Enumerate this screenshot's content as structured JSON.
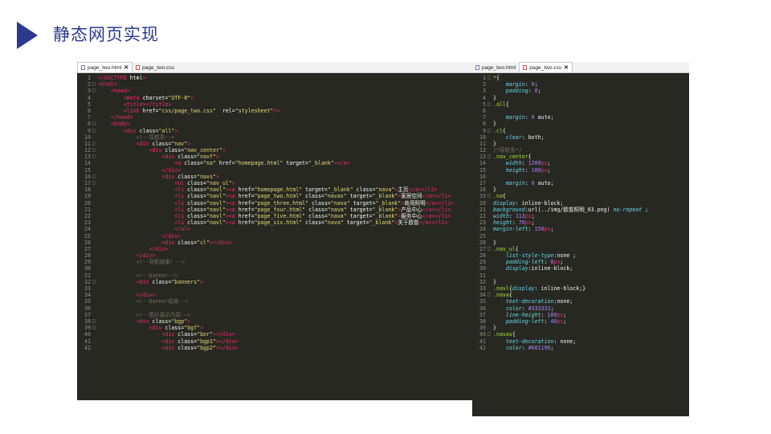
{
  "slide": {
    "title": "静态网页实现"
  },
  "html_editor": {
    "tabs": [
      {
        "label": "page_two.html",
        "active": true,
        "closable": true
      },
      {
        "label": "page_two.css",
        "active": false,
        "closable": false
      }
    ],
    "lines": [
      {
        "n": "1",
        "fold": "",
        "t": "<!DOCTYPE html>"
      },
      {
        "n": "2",
        "fold": "□",
        "t": "<html>"
      },
      {
        "n": "3",
        "fold": "□",
        "t": "    <head>"
      },
      {
        "n": "4",
        "fold": "",
        "t": "        <meta charset=\"UTF-8\">"
      },
      {
        "n": "5",
        "fold": "",
        "t": "        <title></title>"
      },
      {
        "n": "6",
        "fold": "",
        "t": "        <link href=\"css/page_two.css\"  rel=\"stylesheet\"/>"
      },
      {
        "n": "7",
        "fold": "",
        "t": "    </head>"
      },
      {
        "n": "8",
        "fold": "□",
        "t": "    <body>"
      },
      {
        "n": "9",
        "fold": "□",
        "t": "        <div class=\"all\">"
      },
      {
        "n": "10",
        "fold": "",
        "t": "            <!--导航条-->"
      },
      {
        "n": "11",
        "fold": "□",
        "t": "            <div class=\"nav\">"
      },
      {
        "n": "12",
        "fold": "□",
        "t": "                <div class=\"nav_center\">"
      },
      {
        "n": "13",
        "fold": "□",
        "t": "                    <div class=\"navf\">"
      },
      {
        "n": "14",
        "fold": "",
        "t": "                        <a class=\"na\" href=\"homepage.html\" target=\"_blank\"></a>"
      },
      {
        "n": "15",
        "fold": "",
        "t": "                    </div>"
      },
      {
        "n": "16",
        "fold": "□",
        "t": "                    <div class=\"navs\">"
      },
      {
        "n": "17",
        "fold": "□",
        "t": "                        <ul class=\"nav_ul\">"
      },
      {
        "n": "18",
        "fold": "",
        "t": "                        <li class=\"navl\"><a href=\"homepage.html\" target=\"_blank\" class=\"nava\">主页</a></li>"
      },
      {
        "n": "19",
        "fold": "",
        "t": "                        <li class=\"navl\"><a href=\"page_two.html\" class=\"navas\" target=\"_blank\">家居空间</a></li>"
      },
      {
        "n": "20",
        "fold": "",
        "t": "                        <li class=\"navl\"><a href=\"page_three.html\" class=\"nava\" target=\"_blank\">商用照明</a></li>"
      },
      {
        "n": "21",
        "fold": "",
        "t": "                        <li class=\"navl\"><a href=\"page_four.html\" class=\"nava\" target=\"_blank\">产品中心</a></li>"
      },
      {
        "n": "22",
        "fold": "",
        "t": "                        <li class=\"navl\"><a href=\"page_five.html\" class=\"nava\" target=\"_blank\">服务中心</a></li>"
      },
      {
        "n": "23",
        "fold": "",
        "t": "                        <li class=\"navl\"><a href=\"page_six.html\" class=\"nava\" target=\"_blank\">关于欧普</a></li>"
      },
      {
        "n": "24",
        "fold": "",
        "t": "                        </ul>"
      },
      {
        "n": "25",
        "fold": "",
        "t": "                    </div>"
      },
      {
        "n": "26",
        "fold": "",
        "t": "                    <div class=\"cl\"></div>"
      },
      {
        "n": "27",
        "fold": "",
        "t": "                </div>"
      },
      {
        "n": "28",
        "fold": "",
        "t": "            </div>"
      },
      {
        "n": "29",
        "fold": "",
        "t": "            <!--导航结束！-->"
      },
      {
        "n": "30",
        "fold": "",
        "t": ""
      },
      {
        "n": "31",
        "fold": "",
        "t": "            <!--banner-->"
      },
      {
        "n": "32",
        "fold": "□",
        "t": "            <div class=\"banners\">"
      },
      {
        "n": "33",
        "fold": "",
        "t": ""
      },
      {
        "n": "34",
        "fold": "",
        "t": "            </div>"
      },
      {
        "n": "35",
        "fold": "",
        "t": "            <!--banner结束-->"
      },
      {
        "n": "36",
        "fold": "",
        "t": ""
      },
      {
        "n": "37",
        "fold": "",
        "t": "            <!--图片展示内容-->"
      },
      {
        "n": "38",
        "fold": "□",
        "t": "            <div class=\"bgp\">"
      },
      {
        "n": "39",
        "fold": "□",
        "t": "                <div class=\"bgf\">"
      },
      {
        "n": "40",
        "fold": "",
        "t": "                    <div class=\"bor\"></div>"
      },
      {
        "n": "41",
        "fold": "",
        "t": "                    <div class=\"bgp1\"></div>"
      },
      {
        "n": "42",
        "fold": "",
        "t": "                    <div class=\"bgp2\"></div>"
      }
    ]
  },
  "css_editor": {
    "tabs": [
      {
        "label": "page_two.html",
        "active": false,
        "closable": false
      },
      {
        "label": "page_two.css",
        "active": true,
        "closable": true
      }
    ],
    "lines": [
      {
        "n": "1",
        "fold": "□",
        "t": "*{"
      },
      {
        "n": "2",
        "fold": "",
        "t": "    margin: 0;"
      },
      {
        "n": "3",
        "fold": "",
        "t": "    padding: 0;"
      },
      {
        "n": "4",
        "fold": "",
        "t": "}"
      },
      {
        "n": "5",
        "fold": "□",
        "t": ".all{"
      },
      {
        "n": "6",
        "fold": "",
        "t": ""
      },
      {
        "n": "7",
        "fold": "",
        "t": "    margin: 0 auto;"
      },
      {
        "n": "8",
        "fold": "",
        "t": "}"
      },
      {
        "n": "9",
        "fold": "□",
        "t": ".cl{"
      },
      {
        "n": "10",
        "fold": "",
        "t": "    clear: both;"
      },
      {
        "n": "11",
        "fold": "",
        "t": "}"
      },
      {
        "n": "12",
        "fold": "",
        "t": "/*导航条*/"
      },
      {
        "n": "13",
        "fold": "□",
        "t": ".nav_center{"
      },
      {
        "n": "14",
        "fold": "",
        "t": "    width: 1200px;"
      },
      {
        "n": "15",
        "fold": "",
        "t": "    height: 100px;"
      },
      {
        "n": "16",
        "fold": "",
        "t": ""
      },
      {
        "n": "17",
        "fold": "",
        "t": "    margin: 0 auto;"
      },
      {
        "n": "18",
        "fold": "",
        "t": "}"
      },
      {
        "n": "19",
        "fold": "□",
        "t": ".na{"
      },
      {
        "n": "20",
        "fold": "",
        "t": "display: inline-block;"
      },
      {
        "n": "21",
        "fold": "",
        "t": "background:url(../img/欧普照明_03.png) no-repeat ;"
      },
      {
        "n": "22",
        "fold": "",
        "t": "width: 113px;"
      },
      {
        "n": "23",
        "fold": "",
        "t": "height: 70px;"
      },
      {
        "n": "24",
        "fold": "",
        "t": "margin-left: 150px;"
      },
      {
        "n": "25",
        "fold": "",
        "t": ""
      },
      {
        "n": "26",
        "fold": "",
        "t": "}"
      },
      {
        "n": "27",
        "fold": "□",
        "t": ".nav_ul{"
      },
      {
        "n": "28",
        "fold": "",
        "t": "    list-style-type:none ;"
      },
      {
        "n": "29",
        "fold": "",
        "t": "    padding-left: 0px;"
      },
      {
        "n": "30",
        "fold": "",
        "t": "    display:inline-block;"
      },
      {
        "n": "31",
        "fold": "",
        "t": ""
      },
      {
        "n": "32",
        "fold": "",
        "t": "}"
      },
      {
        "n": "33",
        "fold": "",
        "t": ".navl{display: inline-block;}"
      },
      {
        "n": "34",
        "fold": "□",
        "t": ".nava{"
      },
      {
        "n": "35",
        "fold": "",
        "t": "    text-decoration:none;"
      },
      {
        "n": "36",
        "fold": "",
        "t": "    color: #333333;"
      },
      {
        "n": "37",
        "fold": "",
        "t": "    line-height: 100px;"
      },
      {
        "n": "38",
        "fold": "",
        "t": "    padding-left: 40px;"
      },
      {
        "n": "39",
        "fold": "",
        "t": "}"
      },
      {
        "n": "40",
        "fold": "□",
        "t": ".navas{"
      },
      {
        "n": "41",
        "fold": "",
        "t": "    text-decoration: none;"
      },
      {
        "n": "42",
        "fold": "",
        "t": "    color: #001196;"
      }
    ]
  },
  "colors": {
    "accent": "#2b3a8c",
    "editor_bg": "#272822"
  }
}
